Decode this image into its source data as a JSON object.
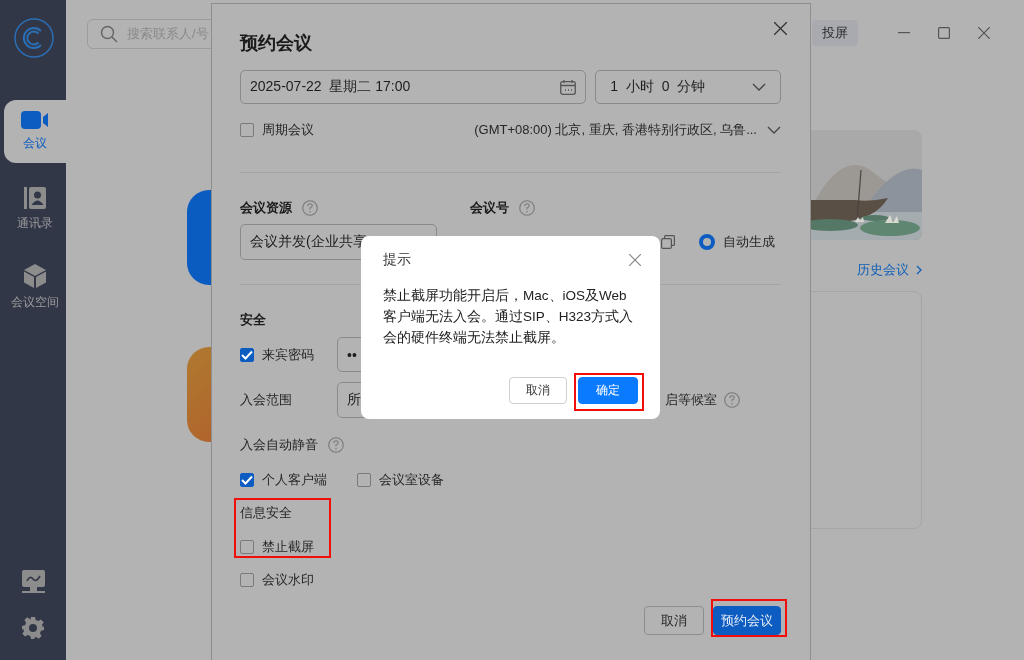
{
  "sidebar": {
    "items": [
      {
        "label": "会议",
        "kind": "video",
        "selected": true
      },
      {
        "label": "通讯录",
        "kind": "contacts",
        "selected": false
      },
      {
        "label": "会议空间",
        "kind": "space",
        "selected": false
      }
    ]
  },
  "topbar": {
    "search": {
      "placeholder": "搜索联系人/号"
    },
    "cast_button": "投屏"
  },
  "history_link": "历史会议",
  "schedule_dialog": {
    "title": "预约会议",
    "start": "2025-07-22  星期二 17:00",
    "duration": "1  小时  0  分钟",
    "recurring": {
      "label": "周期会议",
      "checked": false
    },
    "timezone": "(GMT+08:00) 北京, 重庆, 香港特别行政区, 乌鲁...",
    "resource": {
      "label": "会议资源",
      "value": "会议并发(企业共享"
    },
    "meeting_id": {
      "label": "会议号",
      "options": [
        {
          "label": "自动生成",
          "selected": true
        }
      ]
    },
    "security_heading": "安全",
    "guest_password": {
      "label": "来宾密码",
      "checked": true,
      "value": "••"
    },
    "join_scope": {
      "label": "入会范围",
      "value": "所"
    },
    "waiting_room": {
      "label": "启等候室"
    },
    "auto_mute": {
      "label": "入会自动静音",
      "options": [
        {
          "label": "个人客户端",
          "checked": true
        },
        {
          "label": "会议室设备",
          "checked": false
        }
      ]
    },
    "info_security": {
      "heading": "信息安全",
      "options": [
        {
          "label": "禁止截屏",
          "checked": false
        },
        {
          "label": "会议水印",
          "checked": false
        }
      ]
    },
    "buttons": [
      {
        "label": "取消",
        "kind": "secondary"
      },
      {
        "label": "预约会议",
        "kind": "primary"
      }
    ]
  },
  "alert": {
    "title": "提示",
    "message": "禁止截屏功能开启后，Mac、iOS及Web客户端无法入会。通过SIP、H323方式入会的硬件终端无法禁止截屏。",
    "buttons": [
      {
        "label": "取消",
        "kind": "secondary"
      },
      {
        "label": "确定",
        "kind": "primary"
      }
    ]
  }
}
